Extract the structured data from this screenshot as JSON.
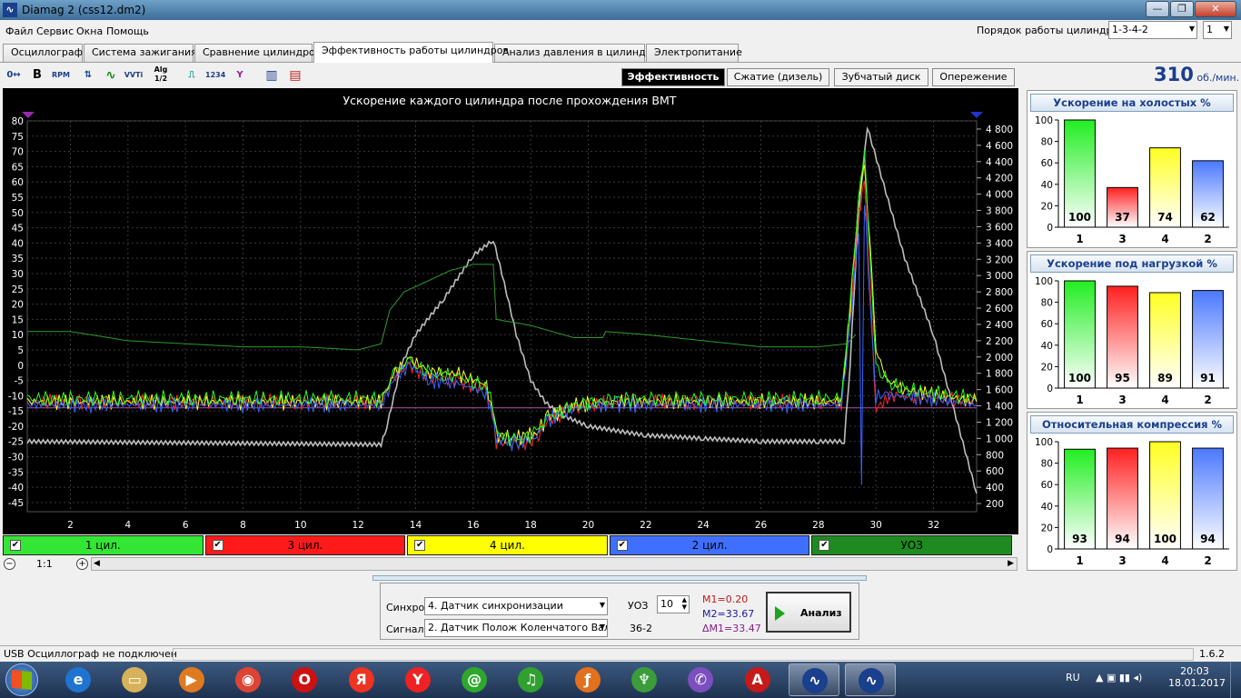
{
  "window": {
    "title": "Diamag 2 (css12.dm2)",
    "min": "—",
    "max": "❐",
    "close": "✕"
  },
  "menu": [
    "Файл",
    "Сервис",
    "Окна",
    "Помощь"
  ],
  "cylinder_order": {
    "label": "Порядок работы цилиндров",
    "value": "1-3-4-2",
    "count": "1"
  },
  "tabs": [
    "Осциллограф",
    "Система зажигания",
    "Сравнение цилиндров",
    "Эффективность работы цилиндров",
    "Анализ давления в цилиндре",
    "Электропитание"
  ],
  "active_tab": "Эффективность работы цилиндров",
  "toolbar": [
    "0↔",
    "B",
    "RPM",
    "⇅",
    "∿",
    "VVTi",
    "Alg 1/2",
    "⎍",
    "1234",
    "Y",
    "▥",
    "▤"
  ],
  "subtabs": [
    "Эффективность",
    "Сжатие (дизель)",
    "Зубчатый диск",
    "Опережение"
  ],
  "active_subtab": "Эффективность",
  "rpm": {
    "value": "310",
    "unit": "об./мин."
  },
  "chart_data": {
    "type": "line",
    "title": "Ускорение каждого цилиндра после прохождения ВМТ",
    "xlim": [
      0.5,
      33.5
    ],
    "x_ticks": [
      "2",
      "4",
      "6",
      "8",
      "10",
      "12",
      "14",
      "16",
      "18",
      "20",
      "22",
      "24",
      "26",
      "28",
      "30",
      "32"
    ],
    "ylim": [
      -48,
      80
    ],
    "y_ticks": [
      "80",
      "75",
      "70",
      "65",
      "60",
      "55",
      "50",
      "45",
      "40",
      "35",
      "30",
      "25",
      "20",
      "15",
      "10",
      "5",
      "0",
      "-5",
      "-10",
      "-15",
      "-20",
      "-25",
      "-30",
      "-35",
      "-40",
      "-45"
    ],
    "y2lim": [
      100,
      4900
    ],
    "y2_ticks": [
      "4 800",
      "4 600",
      "4 400",
      "4 200",
      "4 000",
      "3 800",
      "3 600",
      "3 400",
      "3 200",
      "3 000",
      "2 800",
      "2 600",
      "2 400",
      "2 200",
      "2 000",
      "1 800",
      "1 600",
      "1 400",
      "1 200",
      "1 000",
      "800",
      "600",
      "400",
      "200"
    ],
    "grid": true,
    "reference_line": -14,
    "series": [
      {
        "name": "1 цил.",
        "color": "#22ff22",
        "points": [
          [
            0.5,
            -11
          ],
          [
            12.8,
            -11
          ],
          [
            13.3,
            -2
          ],
          [
            13.8,
            1
          ],
          [
            14.5,
            -3
          ],
          [
            15.5,
            -4
          ],
          [
            16.4,
            -7
          ],
          [
            16.6,
            -10
          ],
          [
            16.8,
            -22
          ],
          [
            17.5,
            -25
          ],
          [
            18.2,
            -22
          ],
          [
            18.6,
            -17
          ],
          [
            19.5,
            -13
          ],
          [
            21,
            -11
          ],
          [
            28.8,
            -11
          ],
          [
            29.1,
            20
          ],
          [
            29.4,
            55
          ],
          [
            29.6,
            70
          ],
          [
            29.8,
            35
          ],
          [
            30,
            0
          ],
          [
            30.4,
            -6
          ],
          [
            31,
            -8
          ],
          [
            33.5,
            -11
          ]
        ]
      },
      {
        "name": "3 цил.",
        "color": "#ff2222",
        "points": [
          [
            0.5,
            -12
          ],
          [
            12.8,
            -12
          ],
          [
            13.3,
            -3
          ],
          [
            13.8,
            0
          ],
          [
            14.5,
            -4
          ],
          [
            15.5,
            -5
          ],
          [
            16.4,
            -8
          ],
          [
            16.6,
            -12
          ],
          [
            16.8,
            -25
          ],
          [
            17.5,
            -26
          ],
          [
            18.2,
            -24
          ],
          [
            18.6,
            -18
          ],
          [
            19.5,
            -14
          ],
          [
            21,
            -12
          ],
          [
            28.8,
            -12
          ],
          [
            29.1,
            15
          ],
          [
            29.4,
            50
          ],
          [
            29.6,
            60
          ],
          [
            29.8,
            25
          ],
          [
            30,
            -15
          ],
          [
            30.4,
            -10
          ],
          [
            31,
            -10
          ],
          [
            33.5,
            -12
          ]
        ]
      },
      {
        "name": "4 цил.",
        "color": "#ffff22",
        "points": [
          [
            0.5,
            -12
          ],
          [
            12.8,
            -12
          ],
          [
            13.3,
            -2
          ],
          [
            13.8,
            2
          ],
          [
            14.5,
            -2
          ],
          [
            15.5,
            -3
          ],
          [
            16.4,
            -6
          ],
          [
            16.6,
            -10
          ],
          [
            16.8,
            -23
          ],
          [
            17.5,
            -24
          ],
          [
            18.2,
            -22
          ],
          [
            18.6,
            -17
          ],
          [
            19.5,
            -13
          ],
          [
            21,
            -12
          ],
          [
            28.8,
            -12
          ],
          [
            29.1,
            18
          ],
          [
            29.4,
            55
          ],
          [
            29.6,
            65
          ],
          [
            29.8,
            40
          ],
          [
            30,
            5
          ],
          [
            30.4,
            -5
          ],
          [
            31,
            -8
          ],
          [
            33.5,
            -12
          ]
        ]
      },
      {
        "name": "2 цил.",
        "color": "#3366ff",
        "points": [
          [
            0.5,
            -13
          ],
          [
            12.8,
            -13
          ],
          [
            13.3,
            -4
          ],
          [
            13.8,
            0
          ],
          [
            14.5,
            -5
          ],
          [
            15.5,
            -6
          ],
          [
            16.4,
            -9
          ],
          [
            16.6,
            -13
          ],
          [
            16.8,
            -24
          ],
          [
            17.5,
            -26
          ],
          [
            18.2,
            -23
          ],
          [
            18.6,
            -18
          ],
          [
            19.5,
            -14
          ],
          [
            21,
            -13
          ],
          [
            28.8,
            -13
          ],
          [
            29.1,
            12
          ],
          [
            29.4,
            45
          ],
          [
            29.5,
            -40
          ],
          [
            29.6,
            55
          ],
          [
            29.8,
            20
          ],
          [
            30,
            -10
          ],
          [
            30.4,
            -10
          ],
          [
            31,
            -10
          ],
          [
            33.5,
            -13
          ]
        ]
      },
      {
        "name": "УОЗ",
        "color": "#2d9a2d",
        "points": [
          [
            0.5,
            11
          ],
          [
            2,
            11
          ],
          [
            4,
            8
          ],
          [
            6,
            7
          ],
          [
            8,
            6
          ],
          [
            10,
            6
          ],
          [
            12,
            5
          ],
          [
            12.8,
            7
          ],
          [
            13.1,
            18
          ],
          [
            13.6,
            24
          ],
          [
            14.3,
            27
          ],
          [
            15.2,
            31
          ],
          [
            16,
            33
          ],
          [
            16.7,
            33
          ],
          [
            16.8,
            15
          ],
          [
            18,
            13
          ],
          [
            19.5,
            9
          ],
          [
            20.5,
            9
          ],
          [
            20.6,
            11
          ],
          [
            22,
            10
          ],
          [
            24,
            8
          ],
          [
            26,
            6
          ],
          [
            28,
            6
          ],
          [
            29,
            7
          ],
          [
            29.3,
            10
          ]
        ]
      },
      {
        "name": "Обороты",
        "color": "#bdbdbd",
        "points": [
          [
            0.5,
            -25
          ],
          [
            12.8,
            -26
          ],
          [
            13,
            -20
          ],
          [
            13.5,
            0
          ],
          [
            14,
            10
          ],
          [
            15,
            22
          ],
          [
            16,
            36
          ],
          [
            16.7,
            41
          ],
          [
            17,
            30
          ],
          [
            17.5,
            10
          ],
          [
            18,
            -5
          ],
          [
            18.5,
            -12
          ],
          [
            19,
            -16
          ],
          [
            20,
            -20
          ],
          [
            22,
            -23
          ],
          [
            24,
            -24
          ],
          [
            26,
            -25
          ],
          [
            28,
            -25
          ],
          [
            28.9,
            -25
          ],
          [
            29.1,
            0
          ],
          [
            29.4,
            50
          ],
          [
            29.7,
            78
          ],
          [
            31,
            35
          ],
          [
            32,
            10
          ],
          [
            33.5,
            -42
          ]
        ]
      }
    ]
  },
  "channels": [
    {
      "label": "1 цил.",
      "bg": "#33e633",
      "color": "#000"
    },
    {
      "label": "3 цил.",
      "bg": "#ff1a1a",
      "color": "#000"
    },
    {
      "label": "4 цил.",
      "bg": "#ffff00",
      "color": "#000"
    },
    {
      "label": "2 цил.",
      "bg": "#3f6fff",
      "color": "#000"
    },
    {
      "label": "УОЗ",
      "bg": "#1f8a1f",
      "color": "#000"
    }
  ],
  "zoom": "1:1",
  "controls": {
    "sync_label": "Синхро:",
    "sync_value": "4.  Датчик синхронизации",
    "signal_label": "Сигнал:",
    "signal_value": "2.  Датчик Полож Коленчатого Вал",
    "uoz_label": "УОЗ",
    "uoz_value": "10",
    "gear": "36-2",
    "m1": "M1=0.20",
    "m2": "M2=33.67",
    "dm": "ΔM1=33.47",
    "analyze": "Анализ"
  },
  "bar_charts": [
    {
      "title": "Ускорение на холостых %",
      "ymax": 100,
      "yticks": [
        "100",
        "80",
        "60",
        "40",
        "20",
        "0"
      ],
      "categories": [
        "1",
        "3",
        "4",
        "2"
      ],
      "values": [
        100,
        37,
        74,
        62
      ]
    },
    {
      "title": "Ускорение под нагрузкой %",
      "ymax": 100,
      "yticks": [
        "100",
        "80",
        "60",
        "40",
        "20",
        "0"
      ],
      "categories": [
        "1",
        "3",
        "4",
        "2"
      ],
      "values": [
        100,
        95,
        89,
        91
      ]
    },
    {
      "title": "Относительная компрессия %",
      "ymax": 100,
      "yticks": [
        "100",
        "80",
        "60",
        "40",
        "20",
        "0"
      ],
      "categories": [
        "1",
        "3",
        "4",
        "2"
      ],
      "values": [
        93,
        94,
        100,
        94
      ]
    }
  ],
  "bar_colors": [
    "#22ee22",
    "#ff2020",
    "#ffff22",
    "#4a78ff"
  ],
  "status": {
    "text": "USB Осциллограф не подключен",
    "version": "1.6.2"
  },
  "taskbar": {
    "apps": [
      {
        "name": "ie-icon",
        "glyph": "e",
        "bg": "#1f74d0"
      },
      {
        "name": "explorer-icon",
        "glyph": "▭",
        "bg": "#d8b25a"
      },
      {
        "name": "media-player-icon",
        "glyph": "▶",
        "bg": "#e07a1f"
      },
      {
        "name": "chrome-icon",
        "glyph": "◉",
        "bg": "#dd4433"
      },
      {
        "name": "opera-icon",
        "glyph": "O",
        "bg": "#cc1111"
      },
      {
        "name": "yandex-browser-icon",
        "glyph": "Я",
        "bg": "#ee3322"
      },
      {
        "name": "yandex-icon",
        "glyph": "Y",
        "bg": "#ee2222"
      },
      {
        "name": "mail-agent-icon",
        "glyph": "@",
        "bg": "#2da82d"
      },
      {
        "name": "music-icon",
        "glyph": "♫",
        "bg": "#30a030"
      },
      {
        "name": "firefox-icon",
        "glyph": "ƒ",
        "bg": "#e2701c"
      },
      {
        "name": "cleaner-icon",
        "glyph": "♆",
        "bg": "#3b9c3b"
      },
      {
        "name": "viber-icon",
        "glyph": "✆",
        "bg": "#7b4fbd"
      },
      {
        "name": "pdf-reader-icon",
        "glyph": "A",
        "bg": "#c41a1a"
      },
      {
        "name": "diamag-icon-1",
        "glyph": "∿",
        "bg": "#1a3f8c"
      },
      {
        "name": "diamag-icon-2",
        "glyph": "∿",
        "bg": "#1a3f8c"
      }
    ],
    "lang": "RU",
    "time": "20:03",
    "date": "18.01.2017"
  }
}
